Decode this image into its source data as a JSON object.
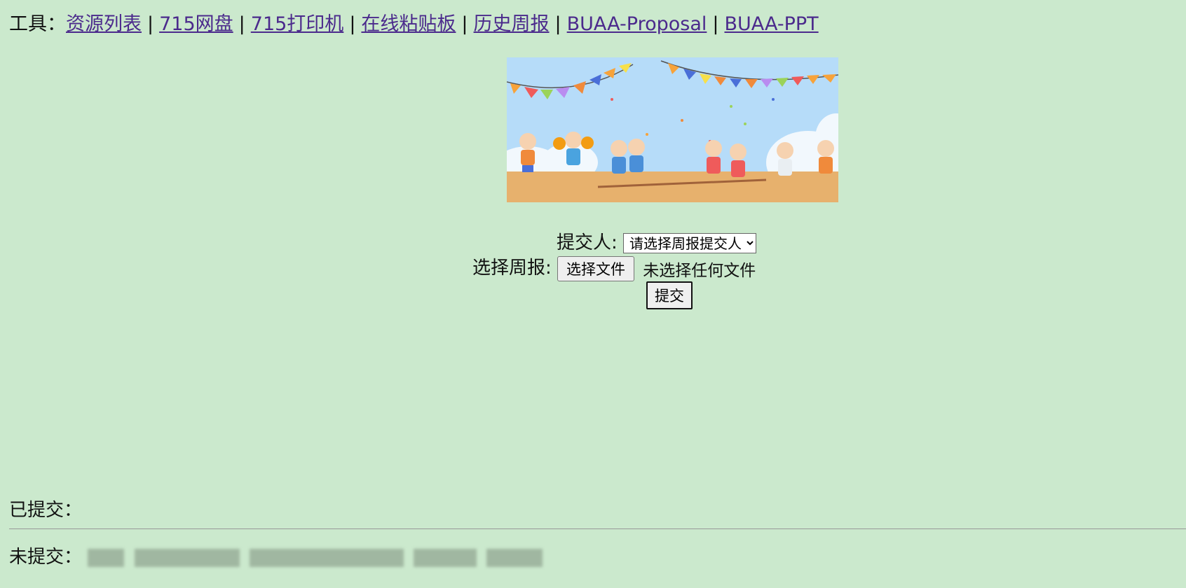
{
  "toolbar": {
    "label": "工具：",
    "links": [
      {
        "text": "资源列表"
      },
      {
        "text": "715网盘"
      },
      {
        "text": "715打印机"
      },
      {
        "text": "在线粘贴板"
      },
      {
        "text": "历史周报"
      },
      {
        "text": "BUAA-Proposal"
      },
      {
        "text": "BUAA-PPT"
      }
    ],
    "separator": "|",
    "link_color": "#4b2a8c"
  },
  "form": {
    "submitter_label": "提交人:",
    "submitter_select": "请选择周报提交人",
    "report_label": "选择周报:",
    "file_button": "选择文件",
    "file_status": "未选择任何文件",
    "submit_button": "提交"
  },
  "status": {
    "submitted_label": "已提交：",
    "unsubmitted_label": "未提交："
  },
  "colors": {
    "background": "#cbe9cd",
    "link": "#4b2a8c"
  }
}
